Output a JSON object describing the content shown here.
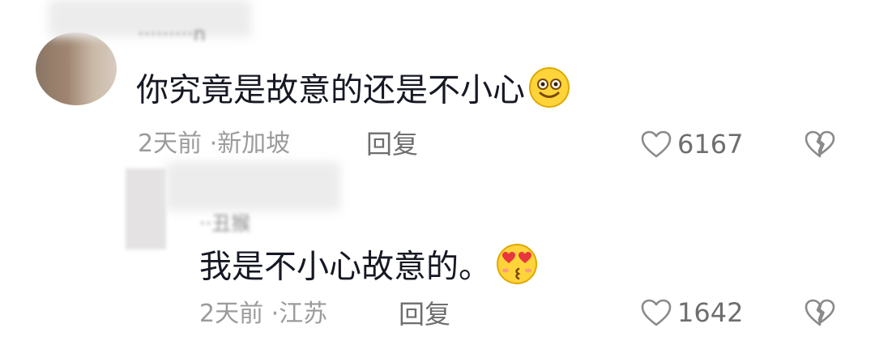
{
  "comments": [
    {
      "username": "·········n",
      "text": "你究竟是故意的还是不小心",
      "emoji_icon": "smiling-face-icon",
      "time": "2天前",
      "separator": "·",
      "location": "新加坡",
      "reply_label": "回复",
      "likes": "6167"
    },
    {
      "username": "··丑猴",
      "text": "我是不小心故意的。",
      "emoji_icon": "face-blowing-kiss-heart-eyes-icon",
      "time": "2天前",
      "separator": "·",
      "location": "江苏",
      "reply_label": "回复",
      "likes": "1642"
    }
  ],
  "colors": {
    "text": "#161823",
    "meta": "#9b9b9b",
    "action": "#6e6e6e",
    "emoji_yellow": "#ffd43b",
    "emoji_heart": "#e8373c"
  }
}
